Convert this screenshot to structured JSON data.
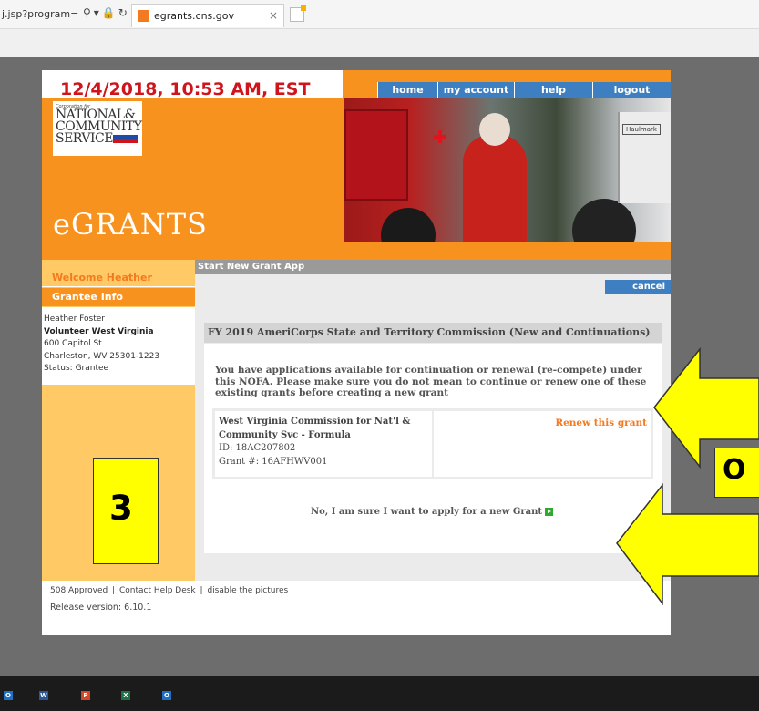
{
  "browser": {
    "url": "j.jsp?program=",
    "tab_title": "egrants.cns.gov",
    "tab_close": "×"
  },
  "header": {
    "datetime": "12/4/2018, 10:53 AM, EST",
    "logo_small": "Corporation for",
    "logo_line1": "NATIONAL&",
    "logo_line2": "COMMUNITY",
    "logo_line3": "SERVICE",
    "brand": "eGRANTS",
    "photo_label": "Haulmark",
    "nav": [
      "home",
      "my account",
      "help",
      "logout"
    ]
  },
  "sidebar": {
    "welcome": "Welcome Heather",
    "grantee_heading": "Grantee Info",
    "name": "Heather Foster",
    "org": "Volunteer West Virginia",
    "address1": "600 Capitol St",
    "address2": "Charleston, WV 25301-1223",
    "status": "Status: Grantee"
  },
  "main": {
    "breadcrumb": "Start New Grant App",
    "cancel": "cancel",
    "fy_title": "FY 2019 AmeriCorps State and Territory Commission (New and Continuations)",
    "notice": "You have applications available for continuation or renewal (re-compete) under this NOFA. Please make sure you do not mean to continue or renew one of these existing grants before creating a new grant",
    "grant": {
      "name_line1": "West Virginia Commission for Nat'l &",
      "name_line2": "Community Svc - Formula",
      "id": "ID: 18AC207802",
      "grant_no": "Grant #: 16AFHWV001",
      "renew": "Renew this grant"
    },
    "new_grant": "No, I am sure I want to apply for a new Grant"
  },
  "footer": {
    "links": [
      "508 Approved",
      "|",
      "Contact Help Desk",
      "|",
      "disable the pictures"
    ],
    "release": "Release version: 6.10.1"
  },
  "annotations": {
    "step": "3",
    "callout": "O"
  },
  "taskbar": {
    "icons": [
      "outlook-icon",
      "word-icon",
      "powerpoint-icon",
      "excel-icon",
      "outlook-icon"
    ],
    "labels": [
      "O",
      "W",
      "P",
      "X",
      "O"
    ]
  },
  "colors": {
    "orange": "#f7921e",
    "blue": "#3d7fc1",
    "red": "#d0141c",
    "yellow": "#ffff00"
  }
}
